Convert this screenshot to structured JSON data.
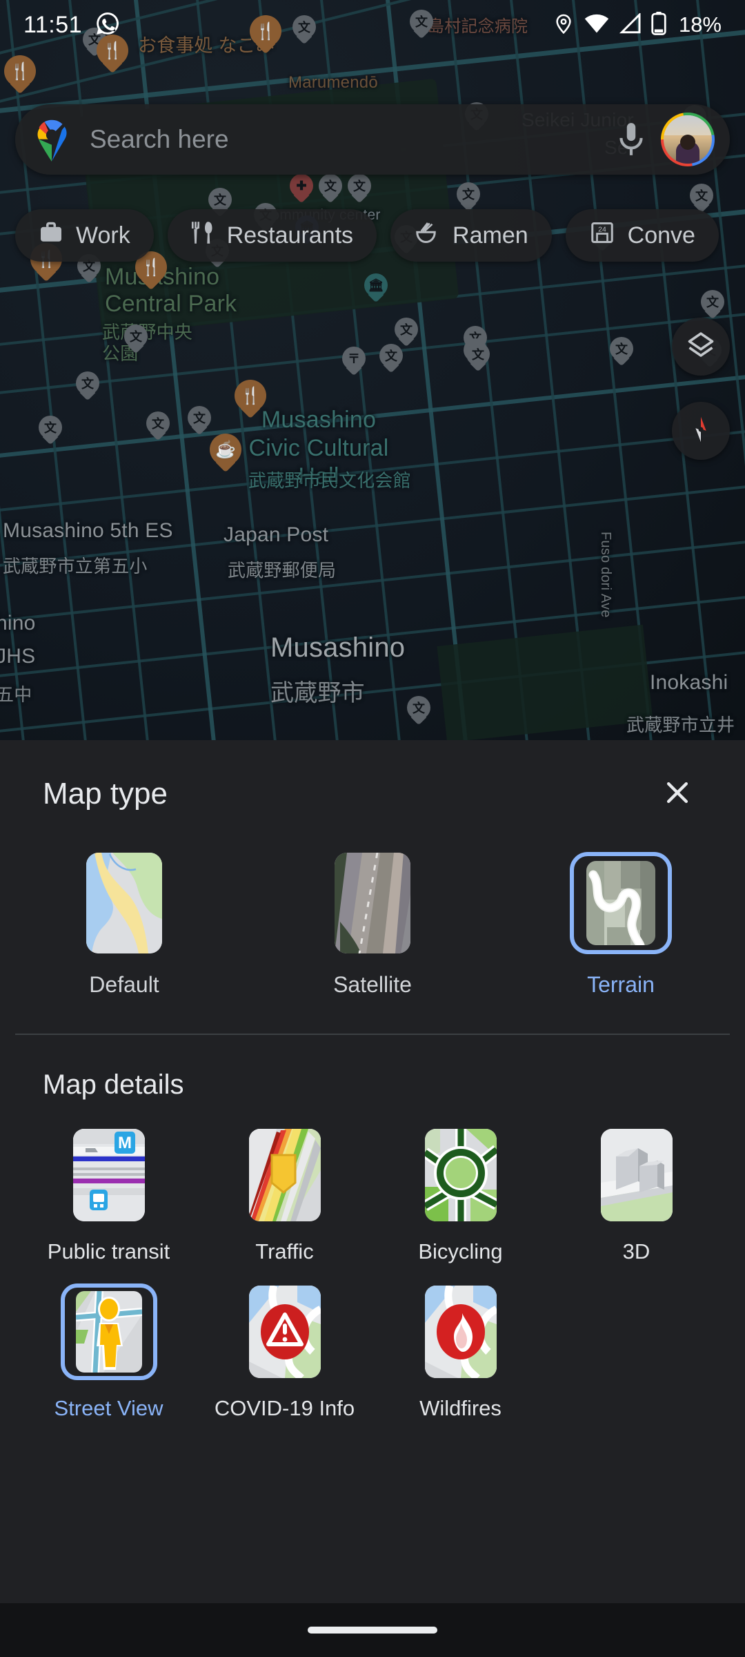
{
  "status_bar": {
    "time": "11:51",
    "battery_percent": "18%",
    "icons": [
      "whatsapp-icon",
      "location-icon",
      "wifi-icon",
      "cellular-signal-icon",
      "battery-icon"
    ]
  },
  "search": {
    "placeholder": "Search here",
    "logo": "google-maps-pin-logo",
    "mic": "microphone-icon",
    "avatar": "account-avatar"
  },
  "chips": [
    {
      "label": "Work",
      "icon": "briefcase-icon"
    },
    {
      "label": "Restaurants",
      "icon": "fork-knife-icon"
    },
    {
      "label": "Ramen",
      "icon": "ramen-bowl-icon"
    },
    {
      "label": "Conve",
      "icon": "convenience-store-icon"
    }
  ],
  "map_controls": {
    "layers": "layers-icon",
    "compass": "compass-icon"
  },
  "map_labels": [
    {
      "text": "島村記念病院",
      "kind": "hospital"
    },
    {
      "text": "お食事処 なごみ",
      "kind": "food"
    },
    {
      "text": "Marumendō",
      "kind": "poi"
    },
    {
      "text": "Community center",
      "kind": "poi"
    },
    {
      "text": "Seikei Junior",
      "kind": "poi"
    },
    {
      "text": "Ser",
      "kind": "poi"
    },
    {
      "text": "Musashino Central Park",
      "kind": "park"
    },
    {
      "text": "武蔵野中央公園",
      "kind": "park-jp"
    },
    {
      "text": "Musashino Civic Cultural Hall",
      "kind": "civic"
    },
    {
      "text": "武蔵野市民文化会館",
      "kind": "civic-jp"
    },
    {
      "text": "Japan Post",
      "kind": "poi"
    },
    {
      "text": "武蔵野郵便局",
      "kind": "poi-jp"
    },
    {
      "text": "Musashino 5th ES",
      "kind": "school"
    },
    {
      "text": "武蔵野市立第五小",
      "kind": "school-jp"
    },
    {
      "text": "Musashino",
      "kind": "city"
    },
    {
      "text": "武蔵野市",
      "kind": "city-jp"
    },
    {
      "text": "Inokashi",
      "kind": "poi"
    },
    {
      "text": "武蔵野市立井",
      "kind": "poi-jp"
    },
    {
      "text": "hino",
      "kind": "poi"
    },
    {
      "text": "JHS",
      "kind": "poi"
    },
    {
      "text": "五中",
      "kind": "poi-jp"
    },
    {
      "text": "Fuso dori Ave",
      "kind": "street"
    }
  ],
  "sheet": {
    "title": "Map type",
    "close": "close-icon",
    "map_types": [
      {
        "label": "Default",
        "selected": false,
        "thumb": "default-map-thumbnail"
      },
      {
        "label": "Satellite",
        "selected": false,
        "thumb": "satellite-map-thumbnail"
      },
      {
        "label": "Terrain",
        "selected": true,
        "thumb": "terrain-map-thumbnail"
      }
    ],
    "details_title": "Map details",
    "map_details": [
      {
        "label": "Public transit",
        "selected": false,
        "thumb": "public-transit-thumbnail"
      },
      {
        "label": "Traffic",
        "selected": false,
        "thumb": "traffic-thumbnail"
      },
      {
        "label": "Bicycling",
        "selected": false,
        "thumb": "bicycling-thumbnail"
      },
      {
        "label": "3D",
        "selected": false,
        "thumb": "3d-buildings-thumbnail"
      },
      {
        "label": "Street View",
        "selected": true,
        "thumb": "street-view-thumbnail"
      },
      {
        "label": "COVID-19 Info",
        "selected": false,
        "thumb": "covid-19-info-thumbnail"
      },
      {
        "label": "Wildfires",
        "selected": false,
        "thumb": "wildfires-thumbnail"
      }
    ]
  },
  "colors": {
    "accent_blue": "#8ab4f8",
    "sheet_bg": "#202124",
    "text_primary": "#e8eaed"
  },
  "nav_bar": {
    "gesture_pill": "home-gesture-pill"
  }
}
